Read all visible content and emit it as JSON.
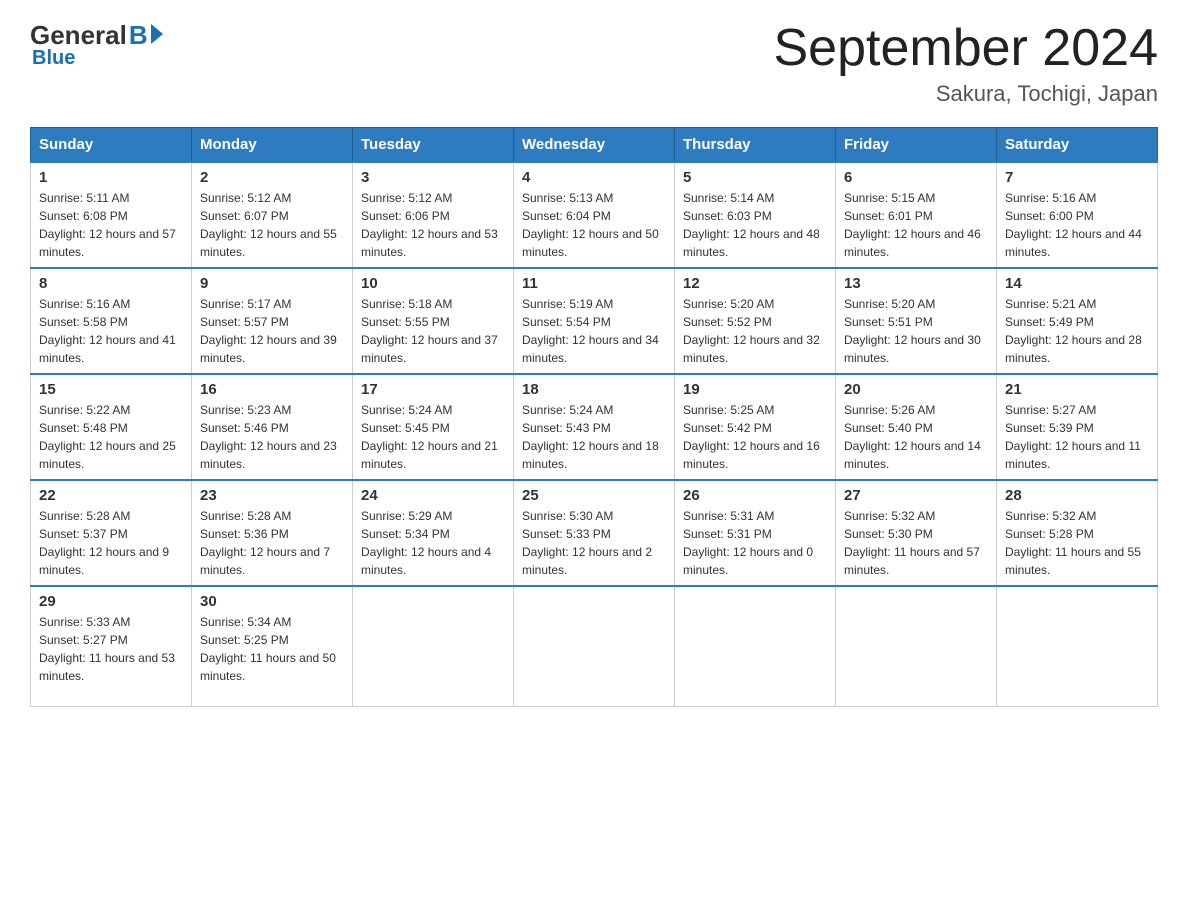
{
  "logo": {
    "general": "General",
    "blue": "Blue"
  },
  "title": "September 2024",
  "location": "Sakura, Tochigi, Japan",
  "weekdays": [
    "Sunday",
    "Monday",
    "Tuesday",
    "Wednesday",
    "Thursday",
    "Friday",
    "Saturday"
  ],
  "weeks": [
    [
      {
        "day": "1",
        "sunrise": "5:11 AM",
        "sunset": "6:08 PM",
        "daylight": "12 hours and 57 minutes."
      },
      {
        "day": "2",
        "sunrise": "5:12 AM",
        "sunset": "6:07 PM",
        "daylight": "12 hours and 55 minutes."
      },
      {
        "day": "3",
        "sunrise": "5:12 AM",
        "sunset": "6:06 PM",
        "daylight": "12 hours and 53 minutes."
      },
      {
        "day": "4",
        "sunrise": "5:13 AM",
        "sunset": "6:04 PM",
        "daylight": "12 hours and 50 minutes."
      },
      {
        "day": "5",
        "sunrise": "5:14 AM",
        "sunset": "6:03 PM",
        "daylight": "12 hours and 48 minutes."
      },
      {
        "day": "6",
        "sunrise": "5:15 AM",
        "sunset": "6:01 PM",
        "daylight": "12 hours and 46 minutes."
      },
      {
        "day": "7",
        "sunrise": "5:16 AM",
        "sunset": "6:00 PM",
        "daylight": "12 hours and 44 minutes."
      }
    ],
    [
      {
        "day": "8",
        "sunrise": "5:16 AM",
        "sunset": "5:58 PM",
        "daylight": "12 hours and 41 minutes."
      },
      {
        "day": "9",
        "sunrise": "5:17 AM",
        "sunset": "5:57 PM",
        "daylight": "12 hours and 39 minutes."
      },
      {
        "day": "10",
        "sunrise": "5:18 AM",
        "sunset": "5:55 PM",
        "daylight": "12 hours and 37 minutes."
      },
      {
        "day": "11",
        "sunrise": "5:19 AM",
        "sunset": "5:54 PM",
        "daylight": "12 hours and 34 minutes."
      },
      {
        "day": "12",
        "sunrise": "5:20 AM",
        "sunset": "5:52 PM",
        "daylight": "12 hours and 32 minutes."
      },
      {
        "day": "13",
        "sunrise": "5:20 AM",
        "sunset": "5:51 PM",
        "daylight": "12 hours and 30 minutes."
      },
      {
        "day": "14",
        "sunrise": "5:21 AM",
        "sunset": "5:49 PM",
        "daylight": "12 hours and 28 minutes."
      }
    ],
    [
      {
        "day": "15",
        "sunrise": "5:22 AM",
        "sunset": "5:48 PM",
        "daylight": "12 hours and 25 minutes."
      },
      {
        "day": "16",
        "sunrise": "5:23 AM",
        "sunset": "5:46 PM",
        "daylight": "12 hours and 23 minutes."
      },
      {
        "day": "17",
        "sunrise": "5:24 AM",
        "sunset": "5:45 PM",
        "daylight": "12 hours and 21 minutes."
      },
      {
        "day": "18",
        "sunrise": "5:24 AM",
        "sunset": "5:43 PM",
        "daylight": "12 hours and 18 minutes."
      },
      {
        "day": "19",
        "sunrise": "5:25 AM",
        "sunset": "5:42 PM",
        "daylight": "12 hours and 16 minutes."
      },
      {
        "day": "20",
        "sunrise": "5:26 AM",
        "sunset": "5:40 PM",
        "daylight": "12 hours and 14 minutes."
      },
      {
        "day": "21",
        "sunrise": "5:27 AM",
        "sunset": "5:39 PM",
        "daylight": "12 hours and 11 minutes."
      }
    ],
    [
      {
        "day": "22",
        "sunrise": "5:28 AM",
        "sunset": "5:37 PM",
        "daylight": "12 hours and 9 minutes."
      },
      {
        "day": "23",
        "sunrise": "5:28 AM",
        "sunset": "5:36 PM",
        "daylight": "12 hours and 7 minutes."
      },
      {
        "day": "24",
        "sunrise": "5:29 AM",
        "sunset": "5:34 PM",
        "daylight": "12 hours and 4 minutes."
      },
      {
        "day": "25",
        "sunrise": "5:30 AM",
        "sunset": "5:33 PM",
        "daylight": "12 hours and 2 minutes."
      },
      {
        "day": "26",
        "sunrise": "5:31 AM",
        "sunset": "5:31 PM",
        "daylight": "12 hours and 0 minutes."
      },
      {
        "day": "27",
        "sunrise": "5:32 AM",
        "sunset": "5:30 PM",
        "daylight": "11 hours and 57 minutes."
      },
      {
        "day": "28",
        "sunrise": "5:32 AM",
        "sunset": "5:28 PM",
        "daylight": "11 hours and 55 minutes."
      }
    ],
    [
      {
        "day": "29",
        "sunrise": "5:33 AM",
        "sunset": "5:27 PM",
        "daylight": "11 hours and 53 minutes."
      },
      {
        "day": "30",
        "sunrise": "5:34 AM",
        "sunset": "5:25 PM",
        "daylight": "11 hours and 50 minutes."
      },
      null,
      null,
      null,
      null,
      null
    ]
  ]
}
